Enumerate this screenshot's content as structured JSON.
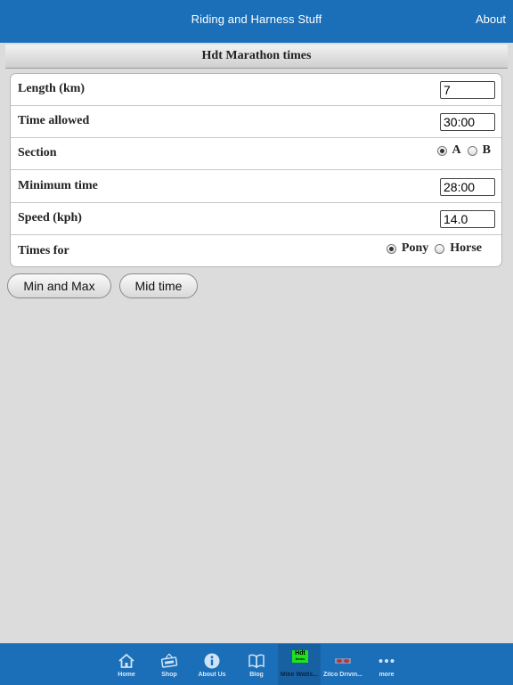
{
  "header": {
    "title": "Riding and Harness Stuff",
    "about": "About"
  },
  "section": {
    "title": "Hdt Marathon times"
  },
  "form": {
    "length": {
      "label": "Length (km)",
      "value": "7"
    },
    "time_allowed": {
      "label": "Time allowed",
      "value": "30:00"
    },
    "section": {
      "label": "Section",
      "options": [
        "A",
        "B"
      ],
      "selected": "A"
    },
    "minimum_time": {
      "label": "Minimum time",
      "value": "28:00"
    },
    "speed": {
      "label": "Speed (kph)",
      "value": "14.0"
    },
    "times_for": {
      "label": "Times for",
      "options": [
        "Pony",
        "Horse"
      ],
      "selected": "Pony"
    }
  },
  "buttons": {
    "min_max": "Min and Max",
    "mid_time": "Mid time"
  },
  "tabbar": {
    "items": [
      {
        "label": "Home",
        "icon": "home-icon"
      },
      {
        "label": "Shop",
        "icon": "shop-icon"
      },
      {
        "label": "About Us",
        "icon": "info-icon"
      },
      {
        "label": "Blog",
        "icon": "book-icon"
      },
      {
        "label": "Mike Watts...",
        "icon": "hdt-icon",
        "icon_text": "Hdt",
        "icon_subtext": "times"
      },
      {
        "label": "Zilco Drivin...",
        "icon": "zilco-icon"
      },
      {
        "label": "more",
        "icon": "more-icon"
      }
    ],
    "active": "Mike Watts..."
  },
  "colors": {
    "bar": "#1a6fb8",
    "background": "#dcdcdc",
    "hdt_icon": "#1fe21f"
  }
}
